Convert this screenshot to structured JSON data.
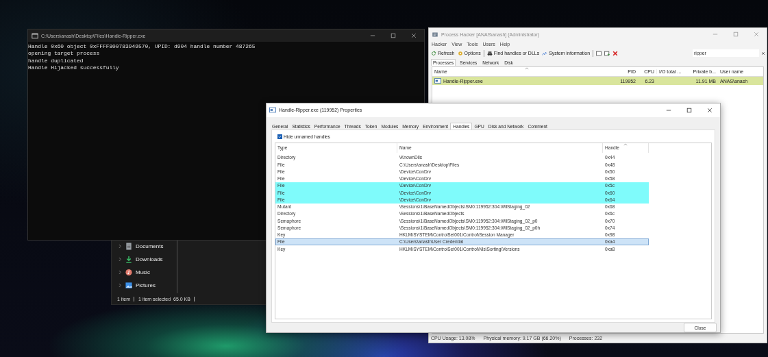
{
  "console": {
    "title": "C:\\Users\\anash\\Desktop\\Files\\Handle-Ripper.exe",
    "lines": [
      "Handle 0x60 object 0xFFFF800783949570, UPID: d904 handle number 487265",
      "opening target process",
      "handle duplicated",
      "Handle Hijacked successfully"
    ]
  },
  "explorer": {
    "nav_items": [
      {
        "label": "Documents",
        "kind": "documents"
      },
      {
        "label": "Downloads",
        "kind": "downloads"
      },
      {
        "label": "Music",
        "kind": "music"
      },
      {
        "label": "Pictures",
        "kind": "pictures"
      }
    ],
    "status": [
      "1 item",
      "1 item selected  65.0 KB"
    ]
  },
  "process_hacker": {
    "title": "Process Hacker [ANAS\\anash] (Administrator)",
    "menu": [
      "Hacker",
      "View",
      "Tools",
      "Users",
      "Help"
    ],
    "toolbar": [
      {
        "label": "Refresh",
        "kind": "refresh"
      },
      {
        "label": "Options",
        "kind": "options"
      },
      {
        "label": "Find handles or DLLs",
        "kind": "find"
      },
      {
        "label": "System information",
        "kind": "sysinfo"
      }
    ],
    "search": {
      "value": "ripper"
    },
    "tabs": [
      {
        "label": "Processes",
        "selected": true
      },
      {
        "label": "Services",
        "selected": false
      },
      {
        "label": "Network",
        "selected": false
      },
      {
        "label": "Disk",
        "selected": false
      }
    ],
    "columns": [
      "Name",
      "PID",
      "CPU",
      "I/O total ...",
      "Private b...",
      "User name"
    ],
    "rows": [
      {
        "cells": [
          "Handle-Ripper.exe",
          "119952",
          "6.23",
          "",
          "11.91 MB",
          "ANAS\\anash"
        ],
        "color": "#d9e59c"
      }
    ],
    "status_bar": [
      "CPU Usage: 13.08%",
      "Physical memory: 9.17 GB (66.20%)",
      "Processes: 232"
    ]
  },
  "properties": {
    "title": "Handle-Ripper.exe (119952) Properties",
    "tabs": [
      {
        "label": "General",
        "selected": false
      },
      {
        "label": "Statistics",
        "selected": false
      },
      {
        "label": "Performance",
        "selected": false
      },
      {
        "label": "Threads",
        "selected": false
      },
      {
        "label": "Token",
        "selected": false
      },
      {
        "label": "Modules",
        "selected": false
      },
      {
        "label": "Memory",
        "selected": false
      },
      {
        "label": "Environment",
        "selected": false
      },
      {
        "label": "Handles",
        "selected": true
      },
      {
        "label": "GPU",
        "selected": false
      },
      {
        "label": "Disk and Network",
        "selected": false
      },
      {
        "label": "Comment",
        "selected": false
      }
    ],
    "hide_unnamed": {
      "label": "Hide unnamed handles",
      "checked": true
    },
    "columns": [
      "Type",
      "Name",
      "Handle"
    ],
    "rows": [
      {
        "cells": [
          "Directory",
          "\\KnownDlls",
          "0x44"
        ],
        "selected": false
      },
      {
        "cells": [
          "File",
          "C:\\Users\\anash\\Desktop\\Files",
          "0x48"
        ],
        "selected": false
      },
      {
        "cells": [
          "File",
          "\\Device\\ConDrv",
          "0x50"
        ],
        "selected": false
      },
      {
        "cells": [
          "File",
          "\\Device\\ConDrv",
          "0x58"
        ],
        "selected": false
      },
      {
        "cells": [
          "File",
          "\\Device\\ConDrv",
          "0x5c"
        ],
        "selected": false,
        "color": "#7ffbfb"
      },
      {
        "cells": [
          "File",
          "\\Device\\ConDrv",
          "0x60"
        ],
        "selected": false,
        "color": "#7ffbfb"
      },
      {
        "cells": [
          "File",
          "\\Device\\ConDrv",
          "0x64"
        ],
        "selected": false,
        "color": "#7ffbfb"
      },
      {
        "cells": [
          "Mutant",
          "\\Sessions\\1\\BaseNamedObjects\\SM0:119952:304:WilStaging_02",
          "0x68"
        ],
        "selected": false
      },
      {
        "cells": [
          "Directory",
          "\\Sessions\\1\\BaseNamedObjects",
          "0x6c"
        ],
        "selected": false
      },
      {
        "cells": [
          "Semaphore",
          "\\Sessions\\1\\BaseNamedObjects\\SM0:119952:304:WilStaging_02_p0",
          "0x70"
        ],
        "selected": false
      },
      {
        "cells": [
          "Semaphore",
          "\\Sessions\\1\\BaseNamedObjects\\SM0:119952:304:WilStaging_02_p0h",
          "0x74"
        ],
        "selected": false
      },
      {
        "cells": [
          "Key",
          "HKLM\\SYSTEM\\ControlSet001\\Control\\Session Manager",
          "0x98"
        ],
        "selected": false
      },
      {
        "cells": [
          "File",
          "C:\\Users\\anash\\User Credential",
          "0xa4"
        ],
        "selected": true
      },
      {
        "cells": [
          "Key",
          "HKLM\\SYSTEM\\ControlSet001\\Control\\Nls\\Sorting\\Versions",
          "0xa8"
        ],
        "selected": false
      }
    ],
    "close_button": "Close"
  }
}
